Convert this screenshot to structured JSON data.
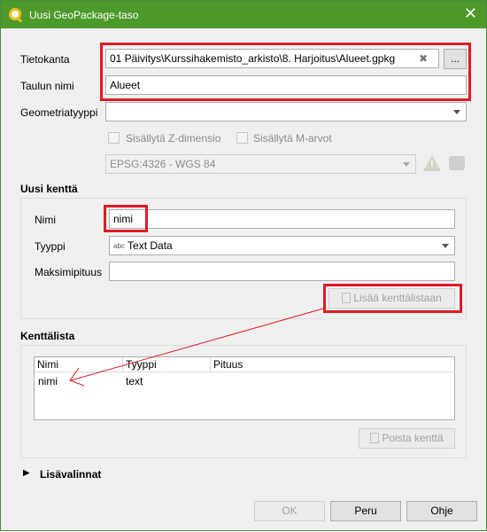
{
  "window": {
    "title": "Uusi GeoPackage-taso",
    "close_glyph": "✕"
  },
  "database": {
    "label": "Tietokanta",
    "value": "01 Päivitys\\Kurssihakemisto_arkisto\\8. Harjoitus\\Alueet.gpkg",
    "clear_glyph": "✖",
    "browse_label": "..."
  },
  "table_name": {
    "label": "Taulun nimi",
    "value": "Alueet"
  },
  "geometry_type": {
    "label": "Geometriatyyppi",
    "value": ""
  },
  "include_z": {
    "label": "Sisällytä Z-dimensio",
    "checked": false
  },
  "include_m": {
    "label": "Sisällytä M-arvot",
    "checked": false
  },
  "crs": {
    "value": "EPSG:4326 - WGS 84"
  },
  "new_field": {
    "group_title": "Uusi kenttä",
    "name_label": "Nimi",
    "name_value": "nimi",
    "type_label": "Tyyppi",
    "type_value": "Text Data",
    "type_icon": "abc",
    "maxlen_label": "Maksimipituus",
    "maxlen_value": "",
    "add_button": "Lisää kenttälistaan"
  },
  "field_list": {
    "group_title": "Kenttälista",
    "columns": [
      "Nimi",
      "Tyyppi",
      "Pituus"
    ],
    "rows": [
      {
        "name": "nimi",
        "type": "text",
        "length": ""
      }
    ],
    "remove_button": "Poista kenttä"
  },
  "advanced": {
    "label": "Lisävalinnat",
    "arrow": "▶"
  },
  "buttons": {
    "ok": "OK",
    "cancel": "Peru",
    "help": "Ohje"
  },
  "colors": {
    "titlebar": "#4c9a2a",
    "highlight": "#e01a24"
  }
}
